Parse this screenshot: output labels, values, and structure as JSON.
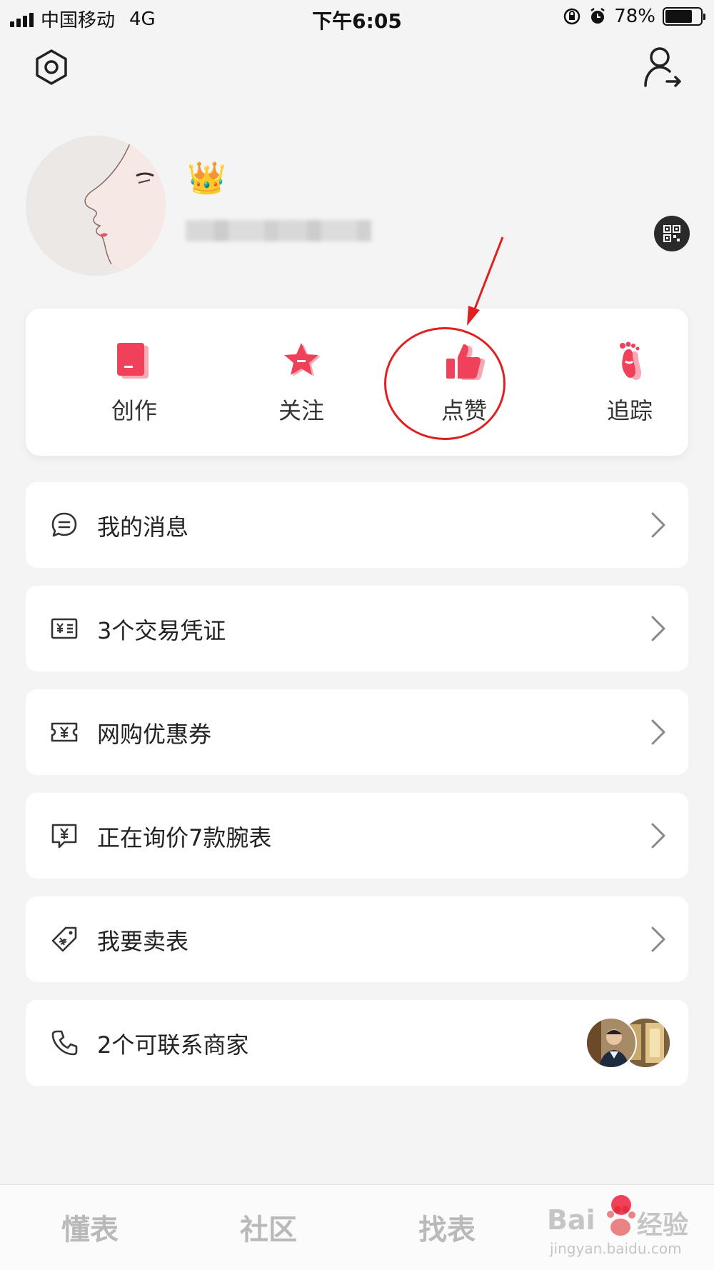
{
  "status_bar": {
    "carrier": "中国移动",
    "network": "4G",
    "time": "下午6:05",
    "battery": "78%",
    "battery_level": 0.78
  },
  "profile": {
    "badge_emoji": "👑"
  },
  "stats": [
    {
      "label": "创作",
      "icon": "document-icon"
    },
    {
      "label": "关注",
      "icon": "star-icon"
    },
    {
      "label": "点赞",
      "icon": "thumbs-up-icon"
    },
    {
      "label": "追踪",
      "icon": "footprint-icon"
    }
  ],
  "menu": [
    {
      "label": "我的消息",
      "icon": "message-icon"
    },
    {
      "label": "3个交易凭证",
      "icon": "receipt-icon"
    },
    {
      "label": "网购优惠券",
      "icon": "coupon-icon"
    },
    {
      "label": "正在询价7款腕表",
      "icon": "inquiry-icon"
    },
    {
      "label": "我要卖表",
      "icon": "tag-icon"
    },
    {
      "label": "2个可联系商家",
      "icon": "phone-icon"
    }
  ],
  "tabs": [
    {
      "label": "懂表"
    },
    {
      "label": "社区"
    },
    {
      "label": "找表"
    }
  ],
  "watermark": {
    "brand": "Bai",
    "brand2": "经验",
    "url": "jingyan.baidu.com"
  },
  "colors": {
    "accent": "#f0415a",
    "annotation": "#e02020",
    "background": "#f4f4f4"
  }
}
